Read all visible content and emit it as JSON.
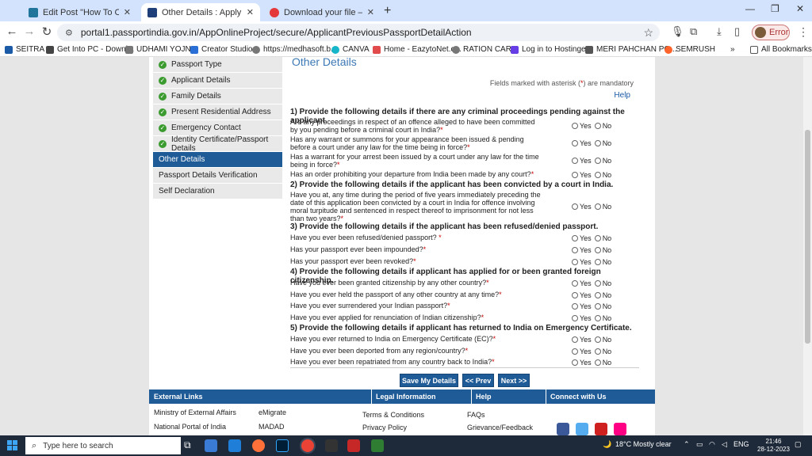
{
  "browser": {
    "tabs": [
      {
        "title": "Edit Post \"How To Change Tatkal",
        "icon_color": "#21759b"
      },
      {
        "title": "Other Details : Apply for Fresh P",
        "icon_color": "#1f3f7a",
        "active": true
      },
      {
        "title": "Download your file — Convertio",
        "icon_color": "#e5383b"
      }
    ],
    "new_tab": "+",
    "url": "portal1.passportindia.gov.in/AppOnlineProject/secure/ApplicantPreviousPassportDetailAction",
    "profile_status": "Error",
    "bookmarks": [
      {
        "label": "SEITRA"
      },
      {
        "label": "Get Into PC - Downl..."
      },
      {
        "label": "UDHAMI YOJNA"
      },
      {
        "label": "Creator Studio"
      },
      {
        "label": "https://medhasoft.b..."
      },
      {
        "label": "CANVA"
      },
      {
        "label": "Home - EazytoNet.c..."
      },
      {
        "label": "RATION CARD"
      },
      {
        "label": "Log in to Hostinger"
      },
      {
        "label": "MERI PAHCHAN PO..."
      },
      {
        "label": "SEMRUSH"
      }
    ],
    "bookmarks_more": "»",
    "all_bookmarks": "All Bookmarks"
  },
  "sidebar": {
    "items": [
      {
        "label": "Passport Type",
        "done": true
      },
      {
        "label": "Applicant Details",
        "done": true
      },
      {
        "label": "Family Details",
        "done": true
      },
      {
        "label": "Present Residential Address",
        "done": true
      },
      {
        "label": "Emergency Contact",
        "done": true
      },
      {
        "label": "Identity Certificate/Passport Details",
        "done": true
      },
      {
        "label": "Other Details",
        "active": true
      },
      {
        "label": "Passport Details Verification"
      },
      {
        "label": "Self Declaration"
      }
    ]
  },
  "form": {
    "title": "Other Details",
    "mandatory_note_pre": "Fields marked with asterisk (",
    "mandatory_asterisk": "*",
    "mandatory_note_post": ") are mandatory",
    "help": "Help",
    "yes_label": "Yes",
    "no_label": "No",
    "asterisk": "*",
    "sections": [
      "1) Provide the following details if there are any criminal proceedings pending against the applicant.",
      "2) Provide the following details if the applicant has been convicted by a court in India.",
      "3) Provide the following details if the applicant has been refused/denied passport.",
      "4) Provide the following details if applicant has applied for or been granted foreign citizenship.",
      "5) Provide the following details if applicant has returned to India on Emergency Certificate."
    ],
    "questions": [
      "Are any proceedings in respect of an offence alleged to have been committed by you pending before a criminal court in India?",
      "Has any warrant or summons for your appearance been issued & pending before a court under any law for the time being in force?",
      "Has a warrant for your arrest been issued by a court under any law for the time being in force?",
      "Has an order prohibiting your departure from India been made by any court?",
      "Have you at, any time during the period of five years immediately preceding the date of this application been convicted by a court in India for offence involving moral turpitude and sentenced in respect thereof to imprisonment for not less than two years?",
      "Have you ever been refused/denied passport?",
      "Has your passport ever been impounded?",
      "Has your passport ever been revoked?",
      "Have you ever been granted citizenship by any other country?",
      "Have you ever held the passport of any other country at any time?",
      "Have you ever surrendered your Indian passport?",
      "Have you ever applied for renunciation of Indian citizenship?",
      "Have you ever returned to India on Emergency Certificate (EC)?",
      "Have you ever been deported from any region/country?",
      "Have you ever been repatriated from any country back to India?"
    ],
    "buttons": {
      "save": "Save My Details",
      "prev": "<< Prev",
      "next": "Next >>"
    }
  },
  "footer": {
    "headings": [
      "External Links",
      "Legal Information",
      "Help",
      "Connect with Us"
    ],
    "links": {
      "mea": "Ministry of External Affairs",
      "emigrate": "eMigrate",
      "terms": "Terms & Conditions",
      "faqs": "FAQs",
      "npi": "National Portal of India",
      "madad": "MADAD",
      "privacy": "Privacy Policy",
      "grievance": "Grievance/Feedback"
    }
  },
  "taskbar": {
    "search_placeholder": "Type here to search",
    "weather": "18°C  Mostly clear",
    "language": "ENG",
    "time": "21:46",
    "date": "28-12-2023"
  }
}
